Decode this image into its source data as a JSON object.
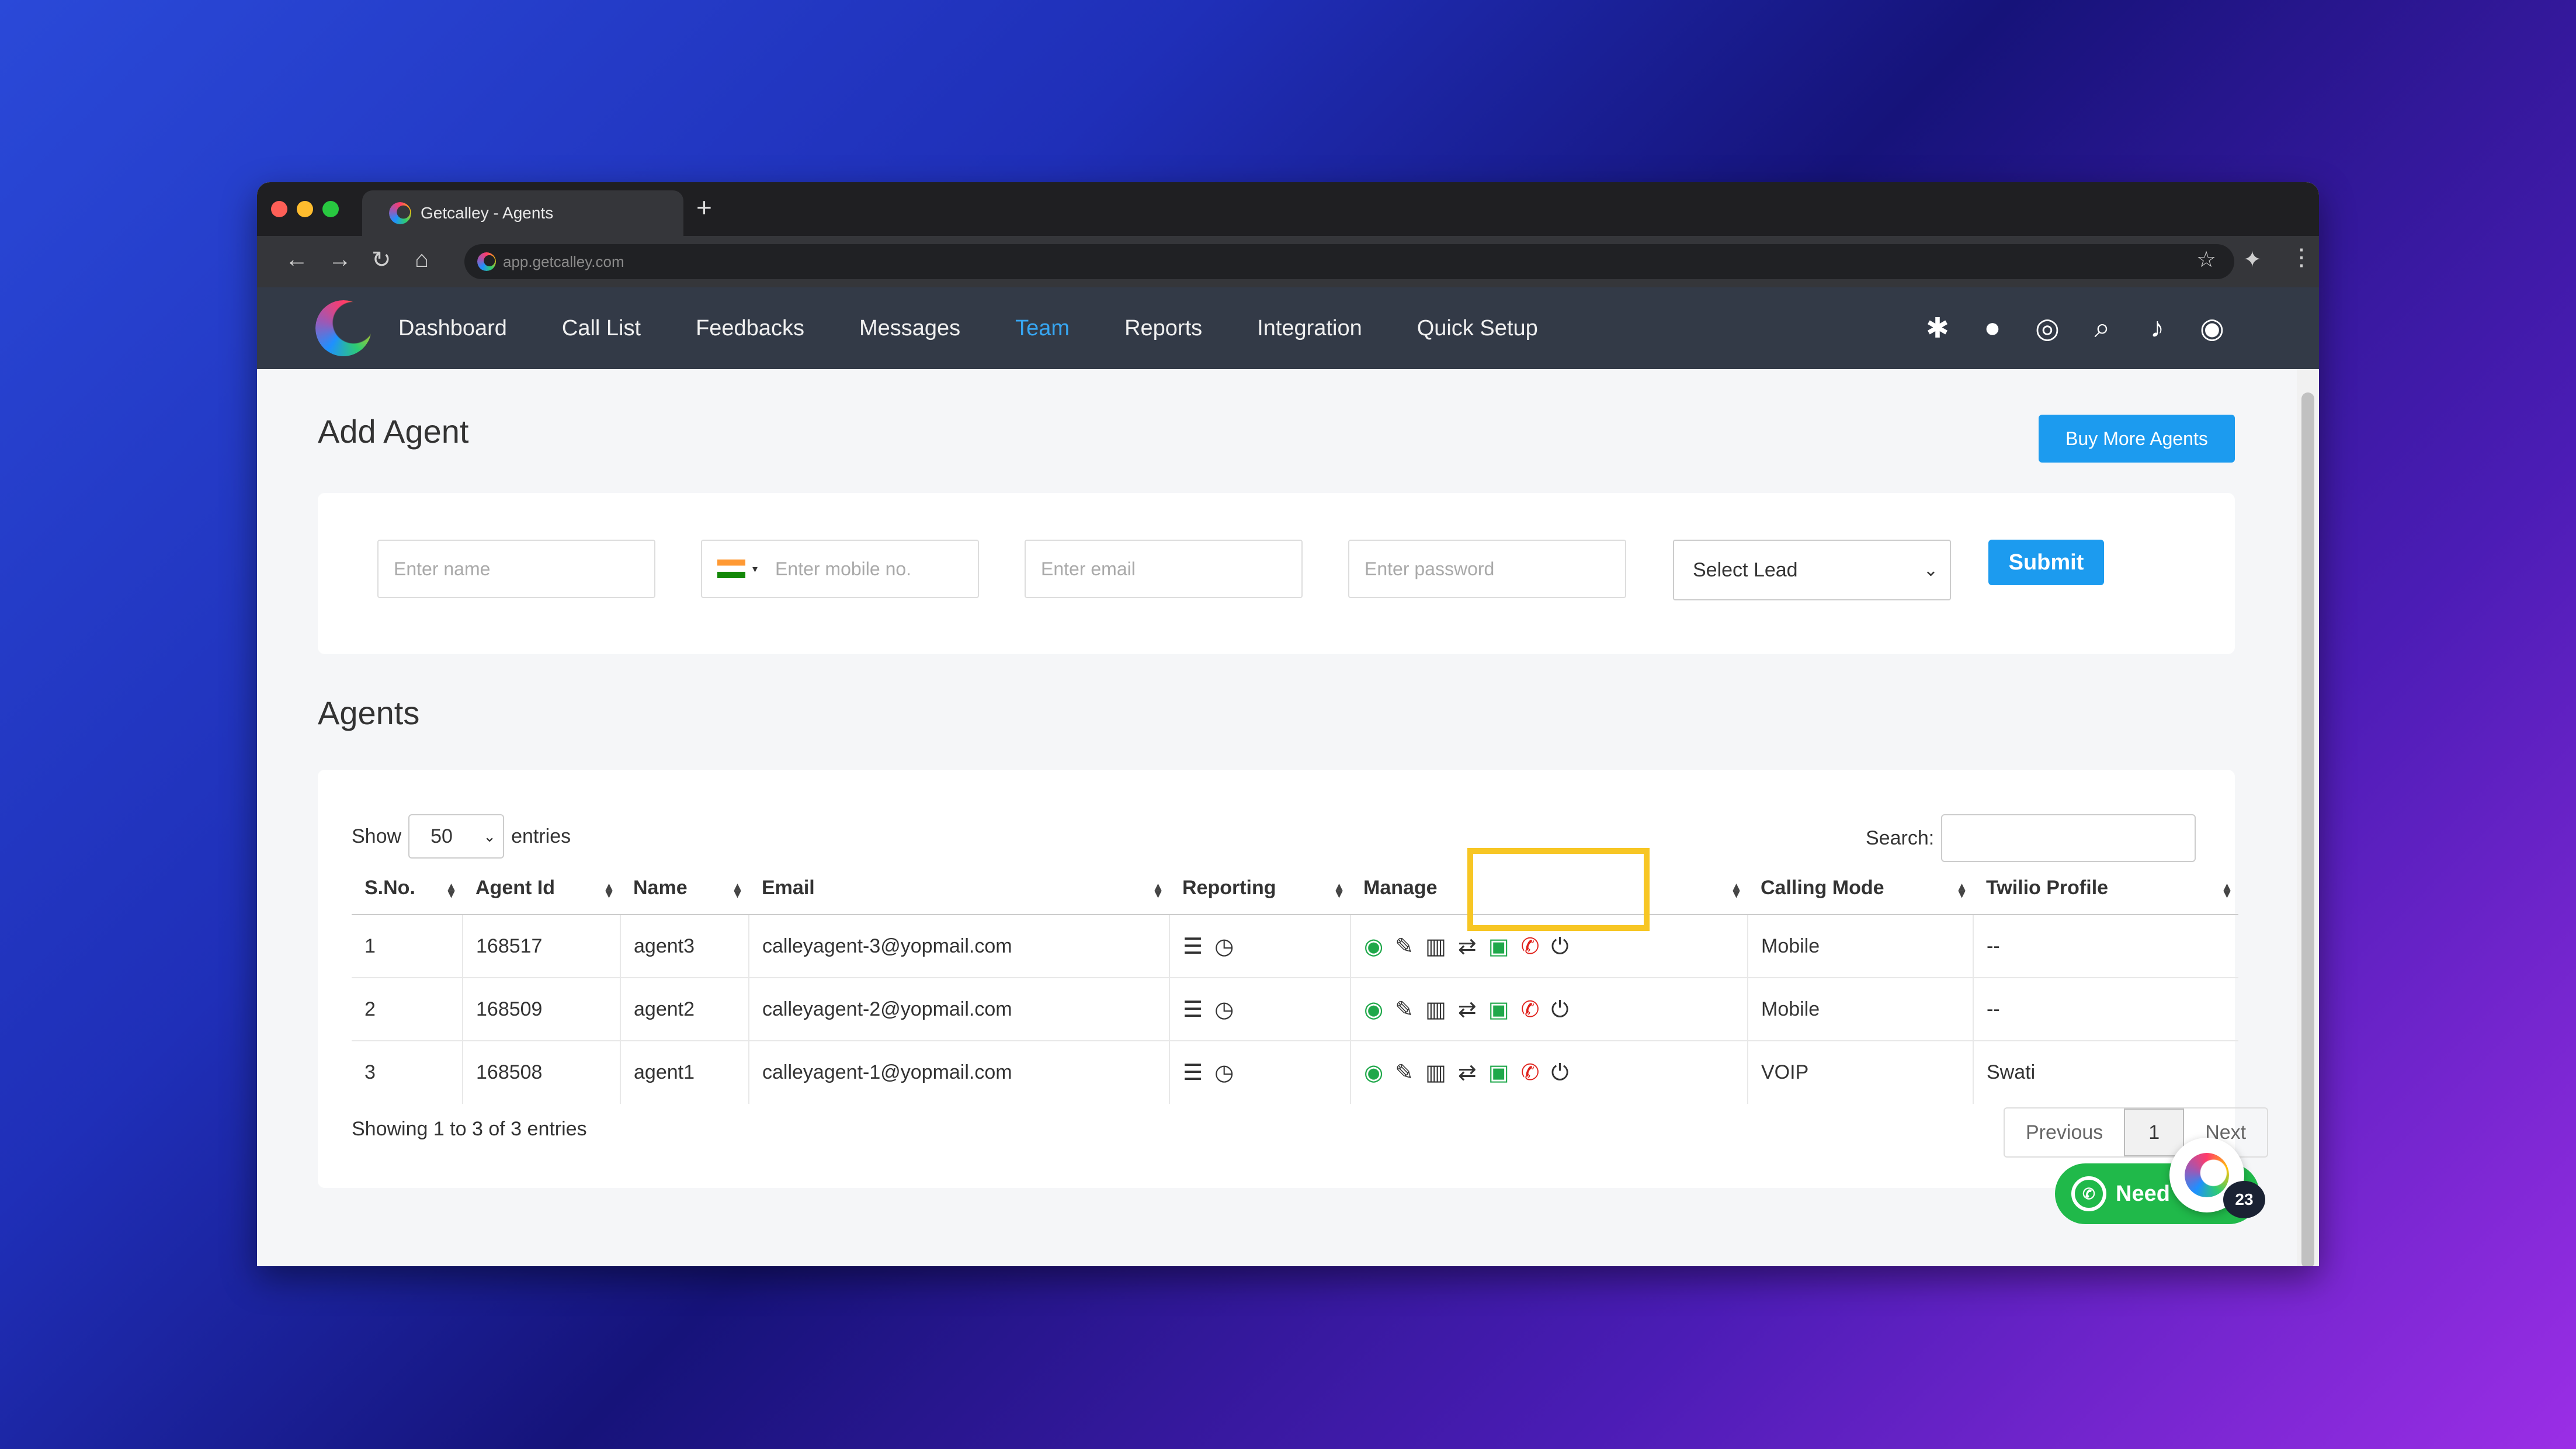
{
  "browser": {
    "tab_title": "Getcalley - Agents",
    "new_tab": "+",
    "url": "app.getcalley.com"
  },
  "nav": {
    "items": [
      "Dashboard",
      "Call List",
      "Feedbacks",
      "Messages",
      "Team",
      "Reports",
      "Integration",
      "Quick Setup"
    ],
    "active": "Team",
    "icons": [
      "android-icon",
      "apple-icon",
      "support-icon",
      "search-icon",
      "bell-icon",
      "user-icon"
    ]
  },
  "add_agent": {
    "title": "Add Agent",
    "buy_button": "Buy More Agents",
    "name_placeholder": "Enter name",
    "mobile_placeholder": "Enter mobile no.",
    "email_placeholder": "Enter email",
    "password_placeholder": "Enter password",
    "lead_select": "Select Lead",
    "submit": "Submit"
  },
  "agents": {
    "title": "Agents",
    "show_label": "Show",
    "entries_value": "50",
    "entries_label": "entries",
    "search_label": "Search:",
    "columns": [
      "S.No.",
      "Agent Id",
      "Name",
      "Email",
      "Reporting",
      "Manage",
      "Calling Mode",
      "Twilio Profile"
    ],
    "rows": [
      {
        "sno": "1",
        "id": "168517",
        "name": "agent3",
        "email": "calleyagent-3@yopmail.com",
        "mode": "Mobile",
        "profile": "--"
      },
      {
        "sno": "2",
        "id": "168509",
        "name": "agent2",
        "email": "calleyagent-2@yopmail.com",
        "mode": "Mobile",
        "profile": "--"
      },
      {
        "sno": "3",
        "id": "168508",
        "name": "agent1",
        "email": "calleyagent-1@yopmail.com",
        "mode": "VOIP",
        "profile": "Swati"
      }
    ],
    "footer": "Showing 1 to 3 of 3 entries",
    "pager": {
      "prev": "Previous",
      "page": "1",
      "next": "Next"
    }
  },
  "chat": {
    "label": "Need",
    "badge": "23"
  },
  "colors": {
    "accent": "#1c9bef",
    "nav_bg": "#333a47",
    "highlight": "#f7c624"
  }
}
